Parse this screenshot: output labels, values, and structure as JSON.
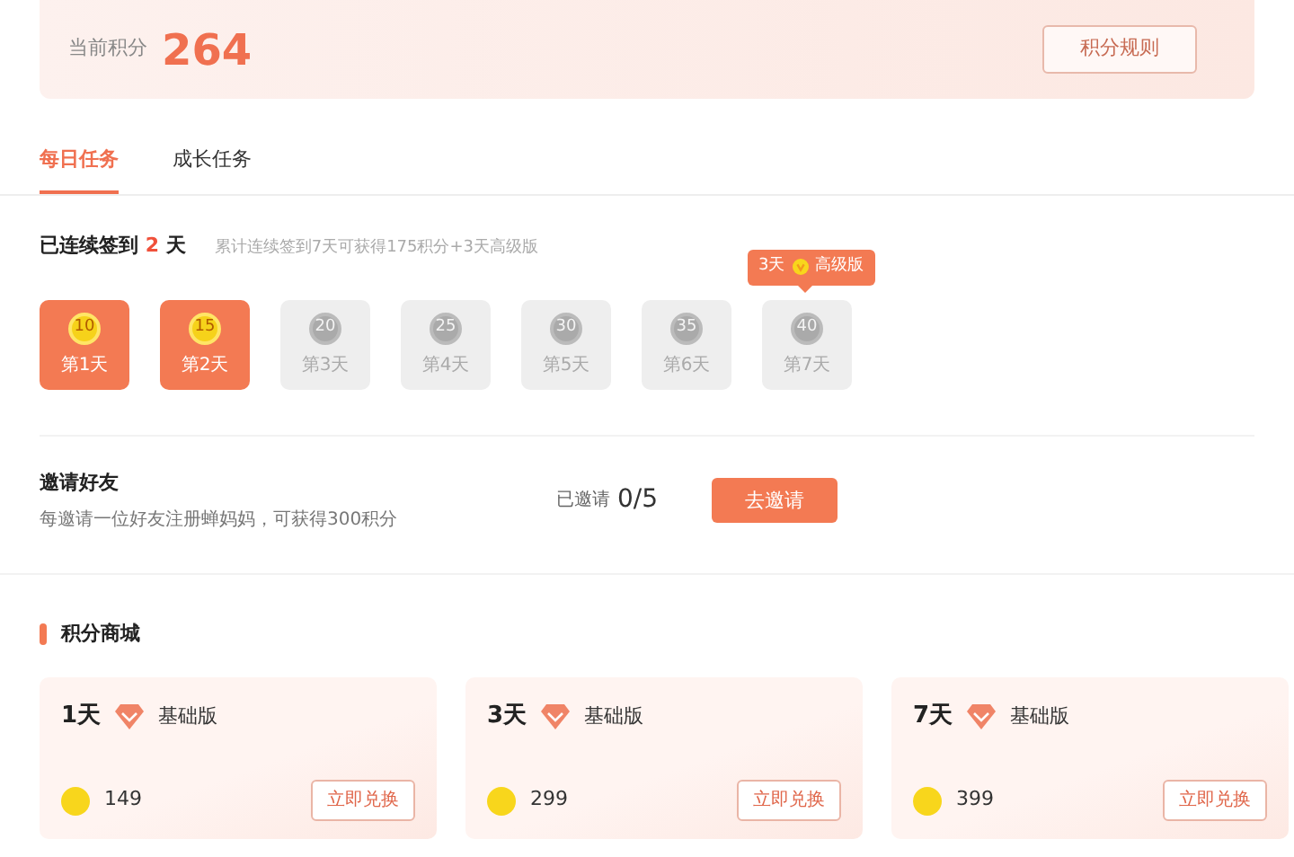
{
  "points": {
    "label": "当前积分",
    "value": "264",
    "rules_button": "积分规则"
  },
  "tabs": [
    {
      "label": "每日任务",
      "selected": true
    },
    {
      "label": "成长任务",
      "selected": false
    }
  ],
  "checkin": {
    "prefix": "已连续签到",
    "days": "2",
    "suffix": "天",
    "hint": "累计连续签到7天可获得175积分+3天高级版",
    "tooltip": {
      "days": "3天",
      "label": "高级版"
    },
    "items": [
      {
        "points": "10",
        "label": "第1天",
        "checked": true
      },
      {
        "points": "15",
        "label": "第2天",
        "checked": true
      },
      {
        "points": "20",
        "label": "第3天",
        "checked": false
      },
      {
        "points": "25",
        "label": "第4天",
        "checked": false
      },
      {
        "points": "30",
        "label": "第5天",
        "checked": false
      },
      {
        "points": "35",
        "label": "第6天",
        "checked": false
      },
      {
        "points": "40",
        "label": "第7天",
        "checked": false
      }
    ]
  },
  "invite": {
    "title": "邀请好友",
    "description": "每邀请一位好友注册蝉妈妈，可获得300积分",
    "count_label": "已邀请",
    "count": "0/5",
    "button": "去邀请"
  },
  "shop": {
    "title": "积分商城",
    "items": [
      {
        "days": "1天",
        "plan": "基础版",
        "price": "149",
        "button": "立即兑换"
      },
      {
        "days": "3天",
        "plan": "基础版",
        "price": "299",
        "button": "立即兑换"
      },
      {
        "days": "7天",
        "plan": "基础版",
        "price": "399",
        "button": "立即兑换"
      }
    ]
  }
}
